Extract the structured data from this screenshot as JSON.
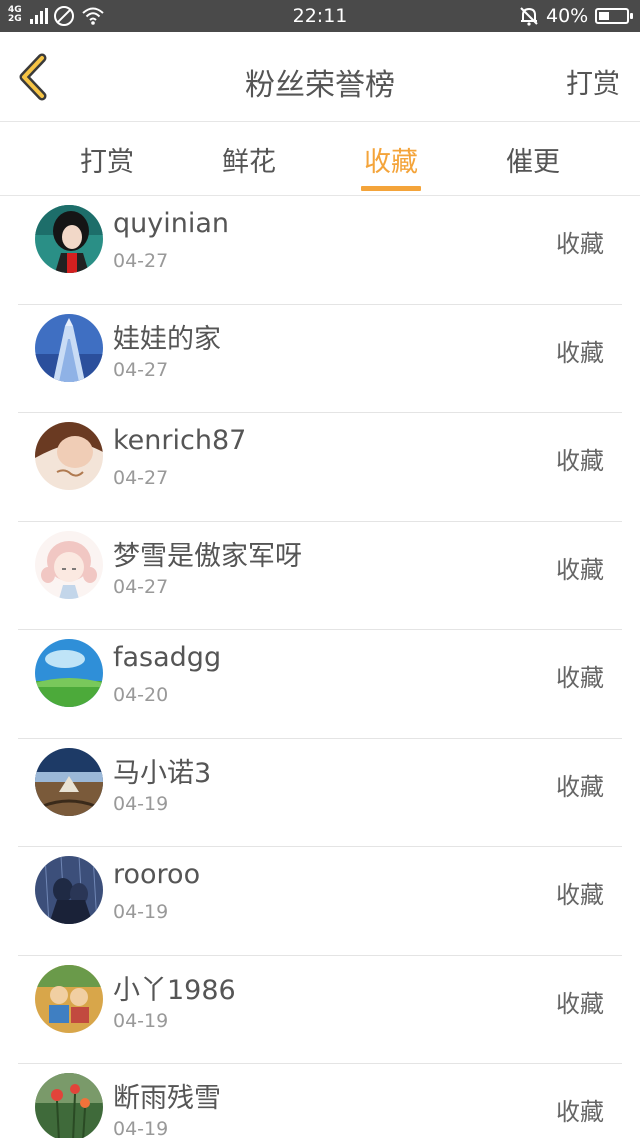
{
  "status_bar": {
    "network": "4G\n2G",
    "time": "22:11",
    "battery_pct": "40%",
    "battery_level": 0.4,
    "icons": [
      "signal-icon",
      "no-sim-icon",
      "wifi-icon",
      "alarm-off-icon",
      "battery-icon"
    ]
  },
  "header": {
    "back_icon": "chevron-left-icon",
    "title": "粉丝荣誉榜",
    "right_action": "打赏"
  },
  "accent_color": "#f4a43a",
  "tabs": [
    {
      "label": "打赏",
      "active": false
    },
    {
      "label": "鲜花",
      "active": false
    },
    {
      "label": "收藏",
      "active": true
    },
    {
      "label": "催更",
      "active": false
    }
  ],
  "list": [
    {
      "name": "quyinian",
      "date": "04-27",
      "action": "收藏",
      "avatar": "anime-boy-avatar"
    },
    {
      "name": "娃娃的家",
      "date": "04-27",
      "action": "收藏",
      "avatar": "building-sky-avatar"
    },
    {
      "name": "kenrich87",
      "date": "04-27",
      "action": "收藏",
      "avatar": "girl-photo-avatar"
    },
    {
      "name": "梦雪是傲家军呀",
      "date": "04-27",
      "action": "收藏",
      "avatar": "anime-girl-avatar"
    },
    {
      "name": "fasadgg",
      "date": "04-20",
      "action": "收藏",
      "avatar": "landscape-avatar"
    },
    {
      "name": "马小诺3",
      "date": "04-19",
      "action": "收藏",
      "avatar": "sunset-avatar"
    },
    {
      "name": "rooroo",
      "date": "04-19",
      "action": "收藏",
      "avatar": "couple-rain-avatar"
    },
    {
      "name": "小丫1986",
      "date": "04-19",
      "action": "收藏",
      "avatar": "cartoon-kids-avatar"
    },
    {
      "name": "断雨残雪",
      "date": "04-19",
      "action": "收藏",
      "avatar": "flowers-avatar"
    }
  ]
}
